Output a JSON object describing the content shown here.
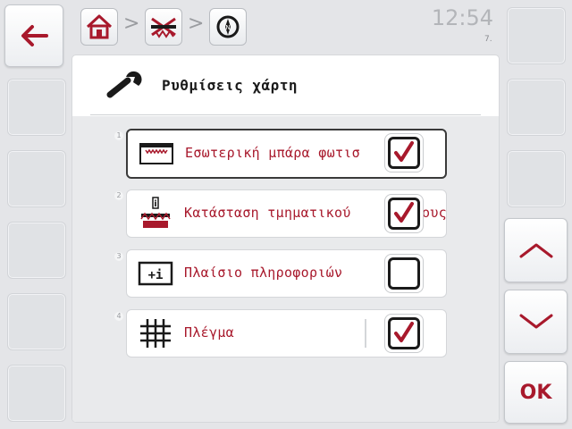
{
  "header": {
    "breadcrumb_separator": ">",
    "clock": "12:54",
    "clock_sub": "7.",
    "breadcrumb_icons": [
      "home-icon",
      "boom-icon",
      "compass-icon"
    ]
  },
  "panel": {
    "title": "Ρυθμίσεις χάρτη",
    "icon": "wrench-icon"
  },
  "items": [
    {
      "num": "1",
      "label": "Εσωτερική μπάρα φωτισ",
      "icon": "lightbar-icon",
      "checked": true,
      "selected": true
    },
    {
      "num": "2",
      "label": "Κατάσταση τμηματικού",
      "label_tail": "ους",
      "icon": "section-status-icon",
      "checked": true,
      "selected": false
    },
    {
      "num": "3",
      "label": "Πλαίσιο πληροφοριών",
      "icon": "info-box-icon",
      "checked": false,
      "selected": false
    },
    {
      "num": "4",
      "label": "Πλέγμα",
      "icon": "grid-icon",
      "checked": true,
      "selected": false
    }
  ],
  "right_buttons": {
    "ok_label": "OK"
  },
  "colors": {
    "accent": "#a8192c",
    "background": "#e4e5e8"
  }
}
